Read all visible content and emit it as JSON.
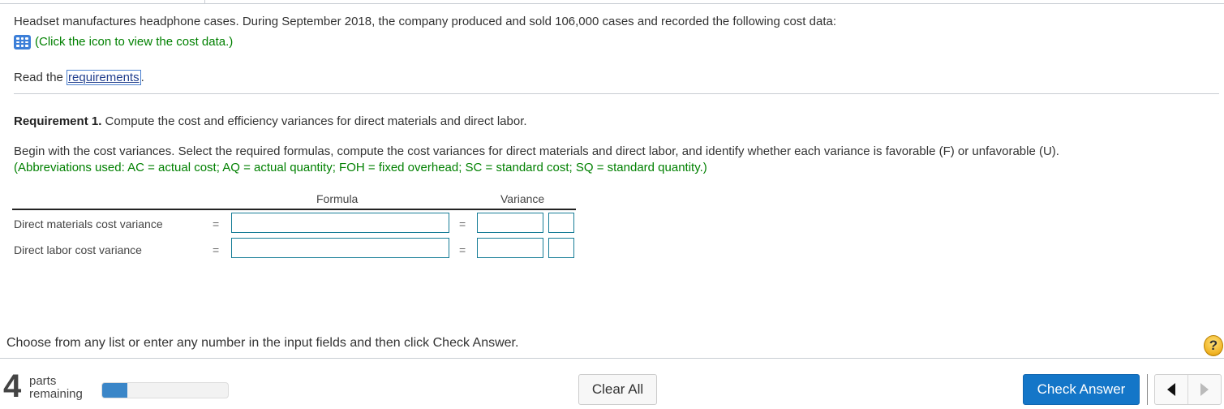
{
  "problem": {
    "intro": "Headset manufactures headphone cases. During September 2018, the company produced and sold 106,000 cases and recorded the following cost data:",
    "cost_data_link": "(Click the icon to view the cost data.)",
    "cost_data_icon": "table-grid-icon",
    "read_prefix": "Read the ",
    "requirements_link": "requirements",
    "read_suffix": "."
  },
  "requirement": {
    "label": "Requirement 1.",
    "text": " Compute the cost and efficiency variances for direct materials and direct labor.",
    "instructions": "Begin with the cost variances. Select the required formulas, compute the cost variances for direct materials and direct labor, and identify whether each variance is favorable (F) or unfavorable (U).",
    "abbreviations": "(Abbreviations used: AC = actual cost; AQ = actual quantity; FOH = fixed overhead; SC = standard cost; SQ = standard quantity.)"
  },
  "table": {
    "headers": {
      "formula": "Formula",
      "variance": "Variance"
    },
    "rows": [
      {
        "label": "Direct materials cost variance",
        "eq1": "=",
        "eq2": "=",
        "formula": "",
        "variance": "",
        "fu": ""
      },
      {
        "label": "Direct labor cost variance",
        "eq1": "=",
        "eq2": "=",
        "formula": "",
        "variance": "",
        "fu": ""
      }
    ]
  },
  "footer": {
    "instruction": "Choose from any list or enter any number in the input fields and then click Check Answer.",
    "help_icon": "?",
    "parts_count": "4",
    "parts_line1": "parts",
    "parts_line2": "remaining",
    "progress_fraction": 0.2,
    "clear_all": "Clear All",
    "check_answer": "Check Answer"
  },
  "colors": {
    "accent": "#1476c8",
    "instruction_green": "#008000",
    "input_border": "#177d97",
    "progress": "#3a86c8"
  }
}
